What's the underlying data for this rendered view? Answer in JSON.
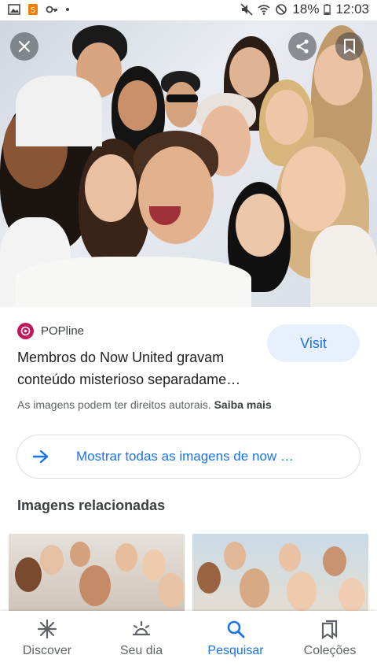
{
  "status_bar": {
    "battery": "18%",
    "time": "12:03"
  },
  "hero": {
    "close_icon": "close-icon",
    "share_icon": "share-icon",
    "bookmark_icon": "bookmark-icon"
  },
  "result": {
    "source": "POPline",
    "title": "Membros do Now United gravam conteúdo misterioso separadame…",
    "visit_label": "Visit",
    "copyright_text": "As imagens podem ter direitos autorais.",
    "learn_more": "Saiba mais"
  },
  "show_all": {
    "label": "Mostrar todas as imagens de now …"
  },
  "related": {
    "heading": "Imagens relacionadas"
  },
  "bottom_nav": {
    "items": [
      {
        "label": "Discover",
        "icon": "asterisk-icon"
      },
      {
        "label": "Seu dia",
        "icon": "sunrise-icon"
      },
      {
        "label": "Pesquisar",
        "icon": "search-icon"
      },
      {
        "label": "Coleções",
        "icon": "bookmarks-icon"
      }
    ],
    "active_index": 2
  },
  "colors": {
    "accent": "#1a73e8",
    "visit_bg": "#e8f0fe",
    "source_logo": "#c2185b"
  }
}
